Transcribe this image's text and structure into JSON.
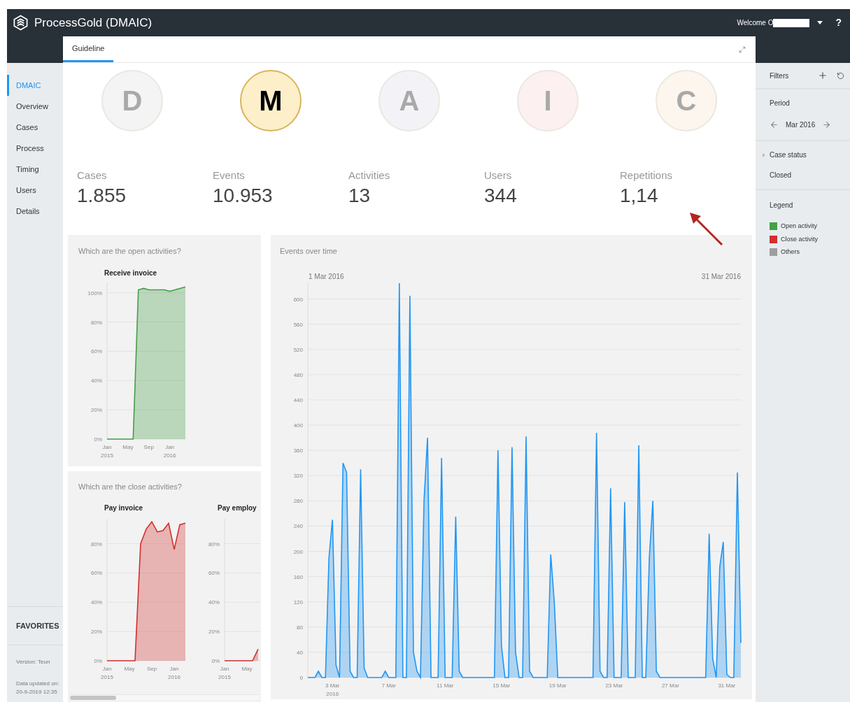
{
  "header": {
    "title": "ProcessGold (DMAIC)",
    "welcome": "Welcome O",
    "help": "?"
  },
  "sidebar": {
    "items": [
      {
        "label": "DMAIC",
        "selected": true
      },
      {
        "label": "Overview",
        "selected": false
      },
      {
        "label": "Cases",
        "selected": false
      },
      {
        "label": "Process",
        "selected": false
      },
      {
        "label": "Timing",
        "selected": false
      },
      {
        "label": "Users",
        "selected": false
      },
      {
        "label": "Details",
        "selected": false
      }
    ],
    "favorites": "FAVORITES",
    "version": "Version: Teun",
    "data_updated_label": "Data updated on:",
    "data_updated_value": "20-9-2019 12:35"
  },
  "tabs": [
    {
      "label": "Guideline",
      "selected": true
    }
  ],
  "steps": [
    {
      "letter": "D",
      "selected": false,
      "color": "#f4f4f4"
    },
    {
      "letter": "M",
      "selected": true,
      "color": "#fcefc9"
    },
    {
      "letter": "A",
      "selected": false,
      "color": "#f3f3f7"
    },
    {
      "letter": "I",
      "selected": false,
      "color": "#fdf0f0"
    },
    {
      "letter": "C",
      "selected": false,
      "color": "#fdf6ee"
    }
  ],
  "stats": [
    {
      "label": "Cases",
      "value": "1.855"
    },
    {
      "label": "Events",
      "value": "10.953"
    },
    {
      "label": "Activities",
      "value": "13"
    },
    {
      "label": "Users",
      "value": "344"
    },
    {
      "label": "Repetitions",
      "value": "1,14"
    }
  ],
  "open_activities": {
    "title": "Which are the open activities?",
    "charts": [
      {
        "chart_data": {
          "type": "area",
          "grid": true,
          "title": "Receive invoice",
          "categories": [
            "Jan\n2015",
            null,
            null,
            null,
            "May",
            null,
            null,
            null,
            "Sep",
            null,
            null,
            null,
            "Jan\n2016",
            null,
            null,
            null
          ],
          "series": [
            {
              "color": "#43a047",
              "values": [
                0,
                0,
                0,
                0,
                0,
                0,
                102,
                103,
                102,
                102,
                102,
                102,
                101,
                102,
                103,
                104
              ]
            }
          ],
          "ylim": [
            0,
            107
          ],
          "yticks": [
            {
              "value": 0,
              "label": "0%"
            },
            {
              "value": 20,
              "label": "20%"
            },
            {
              "value": 40,
              "label": "40%"
            },
            {
              "value": 60,
              "label": "60%"
            },
            {
              "value": 80,
              "label": "80%"
            },
            {
              "value": 100,
              "label": "100%"
            }
          ]
        }
      }
    ]
  },
  "close_activities": {
    "title": "Which are the close activities?",
    "charts": [
      {
        "chart_data": {
          "type": "area",
          "grid": true,
          "title": "Pay invoice",
          "categories": [
            "Jan\n2015",
            null,
            null,
            null,
            "May",
            null,
            null,
            null,
            "Sep",
            null,
            null,
            null,
            "Jan\n2016",
            null,
            null
          ],
          "series": [
            {
              "color": "#d32f2f",
              "values": [
                0,
                0,
                0,
                0,
                0,
                0,
                80,
                90,
                95,
                88,
                89,
                94,
                76,
                93,
                94
              ]
            }
          ],
          "ylim": [
            0,
            97
          ],
          "yticks": [
            {
              "value": 0,
              "label": "0%"
            },
            {
              "value": 20,
              "label": "20%"
            },
            {
              "value": 40,
              "label": "40%"
            },
            {
              "value": 60,
              "label": "60%"
            },
            {
              "value": 80,
              "label": "80%"
            }
          ]
        }
      },
      {
        "chart_data": {
          "type": "area",
          "grid": true,
          "title": "Pay employ",
          "categories": [
            "Jan\n2015",
            null,
            null,
            null,
            "May",
            null,
            null,
            null,
            null,
            null,
            null,
            null,
            null,
            null,
            null
          ],
          "series": [
            {
              "color": "#d32f2f",
              "values": [
                0,
                0,
                0,
                0,
                0,
                0,
                8,
                null,
                null,
                null,
                null,
                null,
                null,
                null,
                null
              ]
            }
          ],
          "ylim": [
            0,
            97
          ],
          "yticks": [
            {
              "value": 0,
              "label": "0%"
            },
            {
              "value": 20,
              "label": "20%"
            },
            {
              "value": 40,
              "label": "40%"
            },
            {
              "value": 60,
              "label": "60%"
            },
            {
              "value": 80,
              "label": "80%"
            }
          ]
        }
      }
    ]
  },
  "events": {
    "title": "Events over time",
    "range_start": "1 Mar 2016",
    "range_end": "31 Mar 2016",
    "chart_data": {
      "type": "area",
      "grid": true,
      "categories": [
        null,
        null,
        null,
        null,
        null,
        null,
        null,
        "3 Mar\n2016",
        null,
        null,
        null,
        null,
        null,
        null,
        null,
        null,
        null,
        null,
        null,
        null,
        null,
        null,
        null,
        "7 Mar",
        null,
        null,
        null,
        null,
        null,
        null,
        null,
        null,
        null,
        null,
        null,
        null,
        null,
        null,
        null,
        "11 Mar",
        null,
        null,
        null,
        null,
        null,
        null,
        null,
        null,
        null,
        null,
        null,
        null,
        null,
        null,
        null,
        "15 Mar",
        null,
        null,
        null,
        null,
        null,
        null,
        null,
        null,
        null,
        null,
        null,
        null,
        null,
        null,
        null,
        "19 Mar",
        null,
        null,
        null,
        null,
        null,
        null,
        null,
        null,
        null,
        null,
        null,
        null,
        null,
        null,
        null,
        "23 Mar",
        null,
        null,
        null,
        null,
        null,
        null,
        null,
        null,
        null,
        null,
        null,
        null,
        null,
        null,
        null,
        "27 Mar",
        null,
        null,
        null,
        null,
        null,
        null,
        null,
        null,
        null,
        null,
        null,
        null,
        null,
        null,
        null,
        "31 Mar",
        null,
        null,
        null,
        null
      ],
      "series": [
        {
          "color": "#2196f3",
          "values": [
            0,
            0,
            0,
            10,
            0,
            0,
            190,
            250,
            20,
            0,
            340,
            325,
            10,
            0,
            0,
            330,
            15,
            0,
            0,
            0,
            0,
            0,
            10,
            0,
            0,
            0,
            625,
            0,
            0,
            605,
            40,
            10,
            0,
            280,
            380,
            0,
            0,
            0,
            348,
            0,
            0,
            0,
            255,
            10,
            0,
            0,
            0,
            0,
            0,
            0,
            0,
            0,
            0,
            0,
            360,
            50,
            0,
            0,
            365,
            40,
            0,
            0,
            382,
            10,
            0,
            0,
            0,
            0,
            0,
            195,
            120,
            0,
            0,
            0,
            0,
            0,
            0,
            0,
            0,
            0,
            0,
            0,
            388,
            10,
            0,
            0,
            300,
            0,
            0,
            0,
            278,
            0,
            0,
            0,
            368,
            0,
            0,
            190,
            280,
            10,
            0,
            0,
            0,
            0,
            0,
            0,
            0,
            0,
            0,
            0,
            0,
            0,
            0,
            0,
            228,
            30,
            0,
            175,
            215,
            5,
            0,
            0,
            325,
            55
          ]
        }
      ],
      "ylim": [
        0,
        625
      ],
      "yticks": [
        {
          "value": 0,
          "label": "0"
        },
        {
          "value": 40,
          "label": "40"
        },
        {
          "value": 80,
          "label": "80"
        },
        {
          "value": 120,
          "label": "120"
        },
        {
          "value": 160,
          "label": "160"
        },
        {
          "value": 200,
          "label": "200"
        },
        {
          "value": 240,
          "label": "240"
        },
        {
          "value": 280,
          "label": "280"
        },
        {
          "value": 320,
          "label": "320"
        },
        {
          "value": 360,
          "label": "360"
        },
        {
          "value": 400,
          "label": "400"
        },
        {
          "value": 440,
          "label": "440"
        },
        {
          "value": 480,
          "label": "480"
        },
        {
          "value": 520,
          "label": "520"
        },
        {
          "value": 560,
          "label": "560"
        },
        {
          "value": 600,
          "label": "600"
        }
      ]
    }
  },
  "filters": {
    "title": "Filters",
    "period_label": "Period",
    "period": "Mar 2016",
    "case_status": "Case status",
    "case_status_value": "Closed",
    "legend_title": "Legend",
    "legend": [
      {
        "label": "Open activity",
        "color": "#43a047"
      },
      {
        "label": "Close activity",
        "color": "#d32f2f"
      },
      {
        "label": "Others",
        "color": "#9e9e9e"
      }
    ]
  }
}
